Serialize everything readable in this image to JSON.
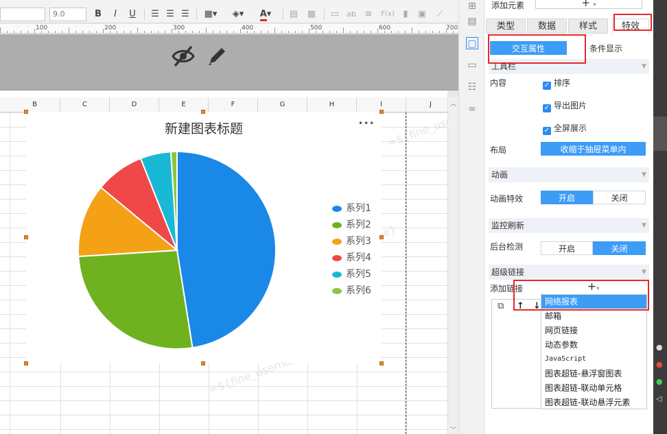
{
  "toolbar": {
    "font_size": "9.0",
    "bold": "B",
    "italic": "I",
    "underline": "U",
    "font_color": "A",
    "text_icon": "ab",
    "formula_icon": "F(x)"
  },
  "ruler": {
    "marks": [
      "100",
      "200",
      "300",
      "400",
      "500",
      "600",
      "700"
    ]
  },
  "sheet": {
    "columns": [
      "B",
      "C",
      "D",
      "E",
      "F",
      "G",
      "H",
      "I",
      "J"
    ],
    "watermark": "=${fine_username}"
  },
  "chart_data": {
    "type": "pie",
    "title": "新建图表标题",
    "more": "•••",
    "series": [
      {
        "name": "系列1",
        "value": 47.5,
        "color": "#1a88e6"
      },
      {
        "name": "系列2",
        "value": 26.5,
        "color": "#6fb21f"
      },
      {
        "name": "系列3",
        "value": 12.0,
        "color": "#f5a116"
      },
      {
        "name": "系列4",
        "value": 8.0,
        "color": "#f04848"
      },
      {
        "name": "系列5",
        "value": 5.0,
        "color": "#19b9d6"
      },
      {
        "name": "系列6",
        "value": 1.0,
        "color": "#8cc63e"
      }
    ],
    "legend_position": "right"
  },
  "panel": {
    "add_element_label": "添加元素",
    "add_symbol": "+",
    "tabs": [
      "类型",
      "数据",
      "样式",
      "特效"
    ],
    "active_tab": "特效",
    "subtabs": [
      "交互属性",
      "条件显示"
    ],
    "active_subtab": "交互属性",
    "toolbar_section": "工具栏",
    "content_label": "内容",
    "checkboxes": [
      "排序",
      "导出图片",
      "全屏展示"
    ],
    "layout_label": "布局",
    "layout_value": "收缩于抽屉菜单内",
    "animation_section": "动画",
    "animation_effect_label": "动画特效",
    "animation_options": [
      "开启",
      "关闭"
    ],
    "animation_active": "开启",
    "monitor_section": "监控刷新",
    "backend_label": "后台检测",
    "backend_options": [
      "开启",
      "关闭"
    ],
    "backend_active": "关闭",
    "hyperlink_section": "超级链接",
    "add_link_label": "添加链接",
    "link_types": [
      "网络报表",
      "邮箱",
      "网页链接",
      "动态参数",
      "JavaScript",
      "图表超链-悬浮窗图表",
      "图表超链-联动单元格",
      "图表超链-联动悬浮元素"
    ],
    "selected_link_type": "网络报表"
  },
  "colors": {
    "accent": "#3d9cf5",
    "highlight_red": "#e8262b",
    "band_gray": "#adadad"
  }
}
